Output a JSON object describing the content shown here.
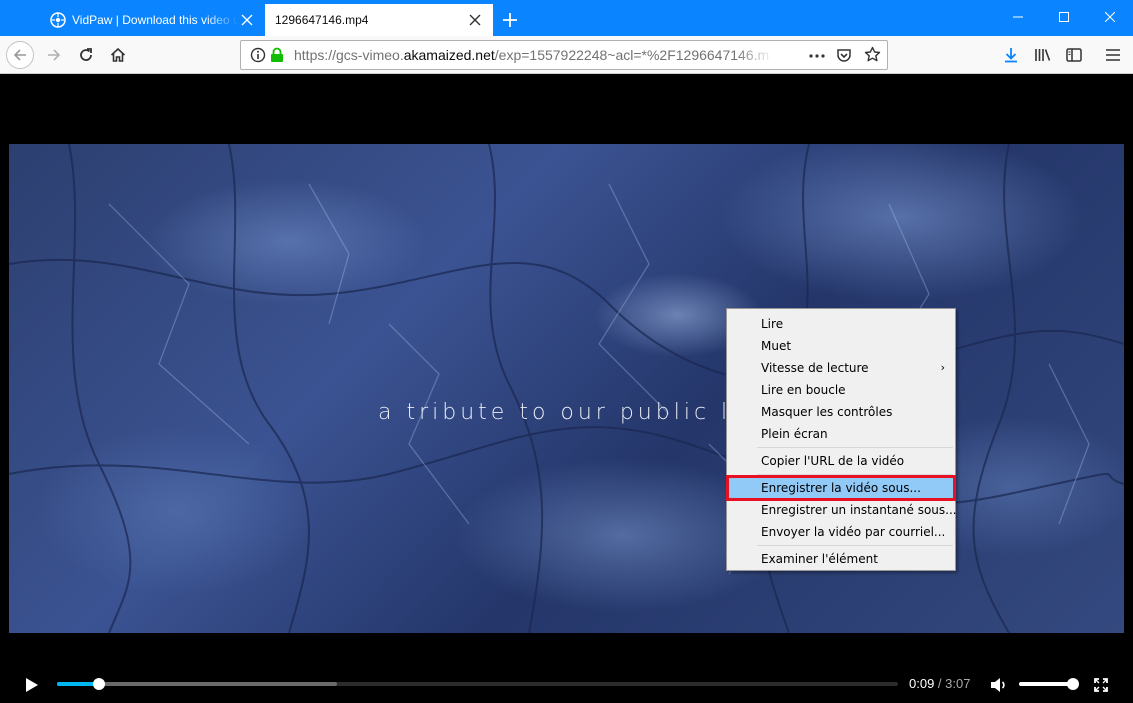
{
  "browser": {
    "tabs": [
      {
        "title": "VidPaw | Download this video u",
        "active": false
      },
      {
        "title": "1296647146.mp4",
        "active": true
      }
    ],
    "new_tab_label": "+",
    "url": {
      "prefix": "https://gcs-vimeo.",
      "domain": "akamaized.net",
      "suffix": "/exp=1557922248~acl=*%2F1296647146.m"
    },
    "accent": "#0a84ff"
  },
  "video": {
    "caption": "a tribute to our public lan",
    "current_time": "0:09",
    "separator": " / ",
    "duration": "3:07",
    "played_fraction": 0.05,
    "buffered_fraction": 0.333,
    "volume_fraction": 0.97
  },
  "context_menu": {
    "items": [
      {
        "label": "Lire",
        "submenu": false
      },
      {
        "label": "Muet",
        "submenu": false
      },
      {
        "label": "Vitesse de lecture",
        "submenu": true
      },
      {
        "label": "Lire en boucle",
        "submenu": false
      },
      {
        "label": "Masquer les contrôles",
        "submenu": false
      },
      {
        "label": "Plein écran",
        "submenu": false
      },
      {
        "label": "Copier l'URL de la vidéo",
        "submenu": false
      },
      {
        "label": "Enregistrer la vidéo sous...",
        "submenu": false,
        "highlighted": true
      },
      {
        "label": "Enregistrer un instantané sous...",
        "submenu": false
      },
      {
        "label": "Envoyer la vidéo par courriel...",
        "submenu": false
      },
      {
        "label": "Examiner l'élément",
        "submenu": false
      }
    ],
    "highlight_color": "#91c9f7",
    "annotation_color": "#e81123"
  }
}
